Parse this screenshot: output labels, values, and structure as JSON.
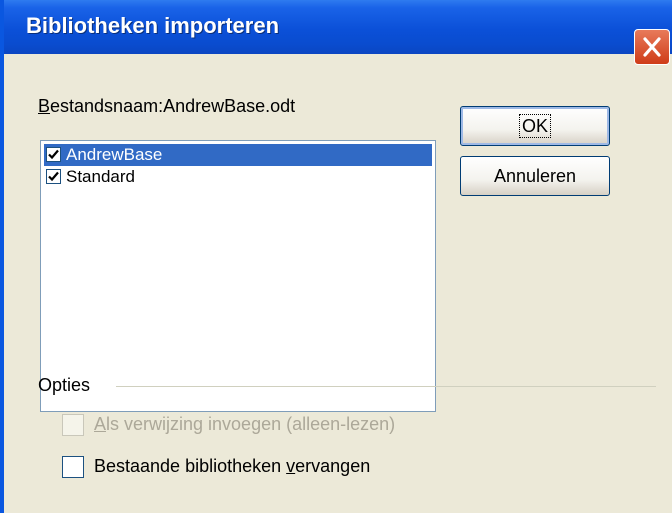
{
  "window": {
    "title": "Bibliotheken importeren"
  },
  "file": {
    "label_mnemonic": "B",
    "label_rest": "estandsnaam:",
    "name": "AndrewBase.odt"
  },
  "libraries": [
    {
      "name": "AndrewBase",
      "checked": true,
      "selected": true
    },
    {
      "name": "Standard",
      "checked": true,
      "selected": false
    }
  ],
  "buttons": {
    "ok_label": "OK",
    "cancel_label": "Annuleren"
  },
  "options": {
    "group_label": "Opties",
    "reference": {
      "mnemonic": "A",
      "rest": "ls verwijzing invoegen (alleen-lezen)",
      "checked": false,
      "disabled": true
    },
    "replace": {
      "before": "Bestaande bibliotheken ",
      "mnemonic": "v",
      "after": "ervangen",
      "checked": false,
      "disabled": false
    }
  },
  "colors": {
    "titlebar": "#0b50d8",
    "dialog_bg": "#ece9d8",
    "selection": "#316ac5",
    "close_button": "#cf3c18"
  }
}
